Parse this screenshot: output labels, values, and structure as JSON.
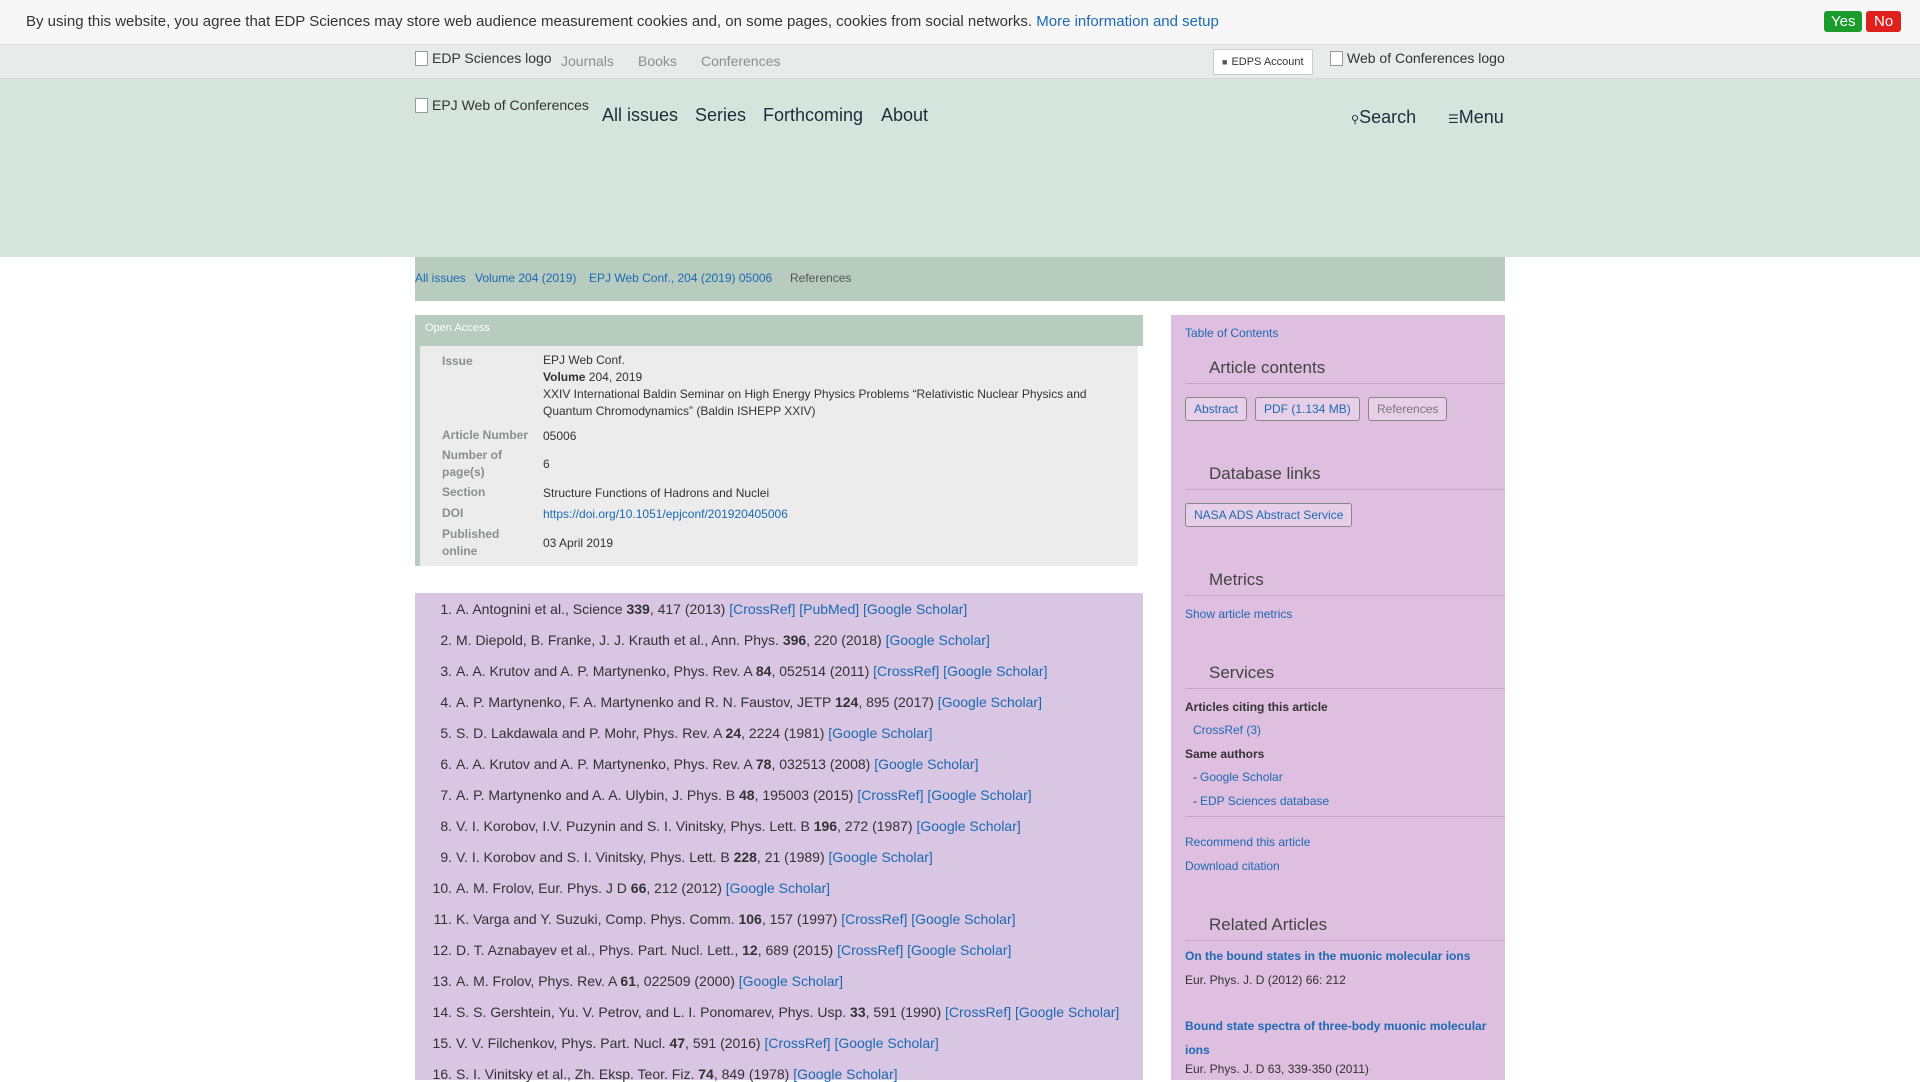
{
  "cookie": {
    "text": "By using this website, you agree that EDP Sciences may store web audience measurement cookies and, on some pages, cookies from social networks.",
    "link": "More information and setup",
    "yes": "Yes",
    "no": "No"
  },
  "topbar": {
    "edp_logo_alt": "EDP Sciences logo",
    "nav": [
      "Journals",
      "Books",
      "Conferences"
    ],
    "edps_account": "EDPS Account",
    "woc_logo_alt": "Web of Conferences logo"
  },
  "header": {
    "logo_alt": "EPJ Web of Conferences",
    "nav": [
      "All issues",
      "Series",
      "Forthcoming",
      "About"
    ],
    "search": "Search",
    "menu": "Menu"
  },
  "breadcrumb": [
    "All issues",
    "Volume 204 (2019)",
    "EPJ Web Conf., 204 (2019) 05006",
    "References"
  ],
  "open_access": "Open Access",
  "info": {
    "issue_label": "Issue",
    "issue_journal": "EPJ Web Conf.",
    "volume_label": "Volume",
    "volume_value": "204, 2019",
    "issue_title": "XXIV International Baldin Seminar on High Energy Physics Problems “Relativistic Nuclear Physics and Quantum Chromodynamics” (Baldin ISHEPP XXIV)",
    "article_number_label": "Article Number",
    "article_number": "05006",
    "pages_label": "Number of page(s)",
    "pages": "6",
    "section_label": "Section",
    "section": "Structure Functions of Hadrons and Nuclei",
    "doi_label": "DOI",
    "doi": "https://doi.org/10.1051/epjconf/201920405006",
    "published_label": "Published online",
    "published": "03 April 2019"
  },
  "references": [
    {
      "num": "1.",
      "pre": "A. Antognini et al., Science ",
      "vol": "339",
      "post": ", 417 (2013) ",
      "links": "[CrossRef] [PubMed] [Google Scholar]"
    },
    {
      "num": "2.",
      "pre": "M. Diepold, B. Franke, J. J. Krauth et al., Ann. Phys. ",
      "vol": "396",
      "post": ", 220 (2018) ",
      "links": "[Google Scholar]"
    },
    {
      "num": "3.",
      "pre": "A. A. Krutov and A. P. Martynenko, Phys. Rev. A ",
      "vol": "84",
      "post": ", 052514 (2011) ",
      "links": "[CrossRef] [Google Scholar]"
    },
    {
      "num": "4.",
      "pre": "A. P. Martynenko, F. A. Martynenko and R. N. Faustov, JETP ",
      "vol": "124",
      "post": ", 895 (2017) ",
      "links": "[Google Scholar]"
    },
    {
      "num": "5.",
      "pre": "S. D. Lakdawala and P. Mohr, Phys. Rev. A ",
      "vol": "24",
      "post": ", 2224 (1981) ",
      "links": "[Google Scholar]"
    },
    {
      "num": "6.",
      "pre": "A. A. Krutov and A. P. Martynenko, Phys. Rev. A ",
      "vol": "78",
      "post": ", 032513 (2008) ",
      "links": "[Google Scholar]"
    },
    {
      "num": "7.",
      "pre": "A. P. Martynenko and A. A. Ulybin, J. Phys. B ",
      "vol": "48",
      "post": ", 195003 (2015) ",
      "links": "[CrossRef] [Google Scholar]"
    },
    {
      "num": "8.",
      "pre": "V. I. Korobov, I.V. Puzynin and S. I. Vinitsky, Phys. Lett. B ",
      "vol": "196",
      "post": ", 272 (1987) ",
      "links": "[Google Scholar]"
    },
    {
      "num": "9.",
      "pre": "V. I. Korobov and S. I. Vinitsky, Phys. Lett. B ",
      "vol": "228",
      "post": ", 21 (1989) ",
      "links": "[Google Scholar]"
    },
    {
      "num": "10.",
      "pre": "A. M. Frolov, Eur. Phys. J D ",
      "vol": "66",
      "post": ", 212 (2012) ",
      "links": "[Google Scholar]"
    },
    {
      "num": "11.",
      "pre": "K. Varga and Y. Suzuki, Comp. Phys. Comm. ",
      "vol": "106",
      "post": ", 157 (1997) ",
      "links": "[CrossRef] [Google Scholar]"
    },
    {
      "num": "12.",
      "pre": "D. T. Aznabayev et al., Phys. Part. Nucl. Lett., ",
      "vol": "12",
      "post": ", 689 (2015) ",
      "links": "[CrossRef] [Google Scholar]"
    },
    {
      "num": "13.",
      "pre": "A. M. Frolov, Phys. Rev. A ",
      "vol": "61",
      "post": ", 022509 (2000) ",
      "links": "[Google Scholar]"
    },
    {
      "num": "14.",
      "pre": "S. S. Gershtein, Yu. V. Petrov, and L. I. Ponomarev, Phys. Usp. ",
      "vol": "33",
      "post": ", 591 (1990) ",
      "links": "[CrossRef] [Google Scholar]"
    },
    {
      "num": "15.",
      "pre": "V. V. Filchenkov, Phys. Part. Nucl. ",
      "vol": "47",
      "post": ", 591 (2016) ",
      "links": "[CrossRef] [Google Scholar]"
    },
    {
      "num": "16.",
      "pre": "S. I. Vinitsky et al., Zh. Eksp. Teor. Fiz. ",
      "vol": "74",
      "post": ", 849 (1978) ",
      "links": "[Google Scholar]"
    }
  ],
  "sidebar": {
    "toc": "Table of Contents",
    "article_contents": "Article contents",
    "btn_abstract": "Abstract",
    "btn_pdf": "PDF (1.134 MB)",
    "btn_references": "References",
    "database_links": "Database links",
    "btn_nasa": "NASA ADS Abstract Service",
    "metrics": "Metrics",
    "show_metrics": "Show article metrics",
    "services": "Services",
    "citing": "Articles citing this article",
    "crossref": "CrossRef (3)",
    "same_authors": "Same authors",
    "google_scholar": "Google Scholar",
    "edp_db": "EDP Sciences database",
    "recommend": "Recommend this article",
    "download": "Download citation",
    "related": "Related Articles",
    "rel1_title": "On the bound states in the muonic molecular ions",
    "rel1_ref": "Eur. Phys. J. D (2012) 66: 212",
    "rel2_title": "Bound state spectra of three-body muonic molecular ions",
    "rel2_ref": "Eur. Phys. J. D 63, 339-350 (2011)"
  }
}
